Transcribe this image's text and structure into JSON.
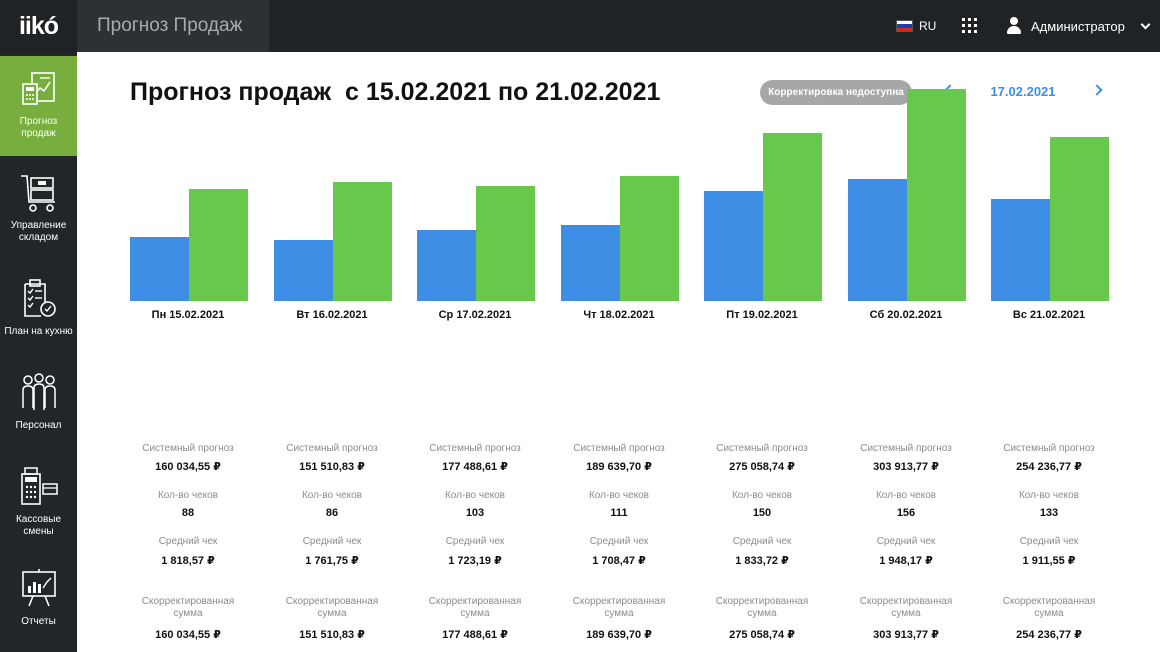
{
  "app": {
    "logo": "iikó",
    "title": "Прогноз Продаж"
  },
  "header": {
    "language": "RU",
    "user_name": "Администратор"
  },
  "sidebar": {
    "items": [
      {
        "label": "Прогноз продаж",
        "icon": "sales-forecast-icon",
        "active": true
      },
      {
        "label": "Управление складом",
        "icon": "warehouse-cart-icon",
        "active": false
      },
      {
        "label": "План на кухню",
        "icon": "kitchen-plan-icon",
        "active": false
      },
      {
        "label": "Персонал",
        "icon": "staff-icon",
        "active": false
      },
      {
        "label": "Кассовые смены",
        "icon": "cash-register-icon",
        "active": false
      },
      {
        "label": "Отчеты",
        "icon": "reports-icon",
        "active": false
      }
    ]
  },
  "main": {
    "title": "Прогноз продаж  с 15.02.2021 по 21.02.2021",
    "correction_button": "Корректировка недоступна",
    "current_date": "17.02.2021",
    "stat_labels": {
      "system_forecast": "Системный прогноз",
      "checks_count": "Кол-во чеков",
      "average_check": "Средний чек",
      "adjusted_sum": "Скорректированная сумма"
    },
    "days": [
      {
        "date": "Пн 15.02.2021",
        "system_forecast": "160 034,55 ₽",
        "checks": "88",
        "avg_check": "1 818,57 ₽",
        "adjusted": "160 034,55 ₽"
      },
      {
        "date": "Вт 16.02.2021",
        "system_forecast": "151 510,83 ₽",
        "checks": "86",
        "avg_check": "1 761,75 ₽",
        "adjusted": "151 510,83 ₽"
      },
      {
        "date": "Ср 17.02.2021",
        "system_forecast": "177 488,61 ₽",
        "checks": "103",
        "avg_check": "1 723,19 ₽",
        "adjusted": "177 488,61 ₽"
      },
      {
        "date": "Чт 18.02.2021",
        "system_forecast": "189 639,70 ₽",
        "checks": "111",
        "avg_check": "1 708,47 ₽",
        "adjusted": "189 639,70 ₽"
      },
      {
        "date": "Пт 19.02.2021",
        "system_forecast": "275 058,74 ₽",
        "checks": "150",
        "avg_check": "1 833,72 ₽",
        "adjusted": "275 058,74 ₽"
      },
      {
        "date": "Сб 20.02.2021",
        "system_forecast": "303 913,77 ₽",
        "checks": "156",
        "avg_check": "1 948,17 ₽",
        "adjusted": "303 913,77 ₽"
      },
      {
        "date": "Вс 21.02.2021",
        "system_forecast": "254 236,77 ₽",
        "checks": "133",
        "avg_check": "1 911,55 ₽",
        "adjusted": "254 236,77 ₽"
      }
    ]
  },
  "colors": {
    "series_blue": "#3e8ee5",
    "series_green": "#67c84b",
    "accent_link": "#3e8ee5",
    "sidebar_active": "#77ae3d"
  },
  "chart_data": {
    "type": "bar",
    "categories": [
      "Пн 15.02.2021",
      "Вт 16.02.2021",
      "Ср 17.02.2021",
      "Чт 18.02.2021",
      "Пт 19.02.2021",
      "Сб 20.02.2021",
      "Вс 21.02.2021"
    ],
    "series": [
      {
        "color": "#3e8ee5",
        "values": [
          160034.55,
          151510.83,
          177488.61,
          189639.7,
          275058.74,
          303913.77,
          254236.77
        ]
      },
      {
        "color": "#67c84b",
        "values": [
          279000,
          298000,
          287000,
          312000,
          421000,
          529000,
          410000
        ]
      }
    ],
    "ylim": [
      0,
      600000
    ],
    "grid": false,
    "legend": "none",
    "title": "",
    "xlabel": "",
    "ylabel": ""
  }
}
